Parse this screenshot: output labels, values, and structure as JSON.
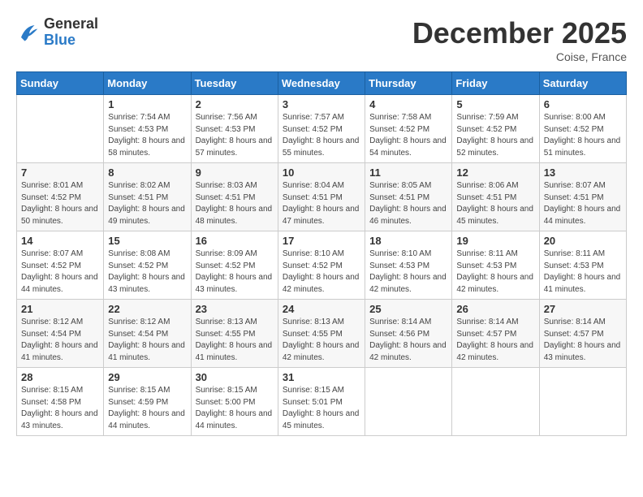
{
  "header": {
    "logo_general": "General",
    "logo_blue": "Blue",
    "month_title": "December 2025",
    "location": "Coise, France"
  },
  "weekdays": [
    "Sunday",
    "Monday",
    "Tuesday",
    "Wednesday",
    "Thursday",
    "Friday",
    "Saturday"
  ],
  "weeks": [
    [
      {
        "day": "",
        "sunrise": "",
        "sunset": "",
        "daylight": ""
      },
      {
        "day": "1",
        "sunrise": "Sunrise: 7:54 AM",
        "sunset": "Sunset: 4:53 PM",
        "daylight": "Daylight: 8 hours and 58 minutes."
      },
      {
        "day": "2",
        "sunrise": "Sunrise: 7:56 AM",
        "sunset": "Sunset: 4:53 PM",
        "daylight": "Daylight: 8 hours and 57 minutes."
      },
      {
        "day": "3",
        "sunrise": "Sunrise: 7:57 AM",
        "sunset": "Sunset: 4:52 PM",
        "daylight": "Daylight: 8 hours and 55 minutes."
      },
      {
        "day": "4",
        "sunrise": "Sunrise: 7:58 AM",
        "sunset": "Sunset: 4:52 PM",
        "daylight": "Daylight: 8 hours and 54 minutes."
      },
      {
        "day": "5",
        "sunrise": "Sunrise: 7:59 AM",
        "sunset": "Sunset: 4:52 PM",
        "daylight": "Daylight: 8 hours and 52 minutes."
      },
      {
        "day": "6",
        "sunrise": "Sunrise: 8:00 AM",
        "sunset": "Sunset: 4:52 PM",
        "daylight": "Daylight: 8 hours and 51 minutes."
      }
    ],
    [
      {
        "day": "7",
        "sunrise": "Sunrise: 8:01 AM",
        "sunset": "Sunset: 4:52 PM",
        "daylight": "Daylight: 8 hours and 50 minutes."
      },
      {
        "day": "8",
        "sunrise": "Sunrise: 8:02 AM",
        "sunset": "Sunset: 4:51 PM",
        "daylight": "Daylight: 8 hours and 49 minutes."
      },
      {
        "day": "9",
        "sunrise": "Sunrise: 8:03 AM",
        "sunset": "Sunset: 4:51 PM",
        "daylight": "Daylight: 8 hours and 48 minutes."
      },
      {
        "day": "10",
        "sunrise": "Sunrise: 8:04 AM",
        "sunset": "Sunset: 4:51 PM",
        "daylight": "Daylight: 8 hours and 47 minutes."
      },
      {
        "day": "11",
        "sunrise": "Sunrise: 8:05 AM",
        "sunset": "Sunset: 4:51 PM",
        "daylight": "Daylight: 8 hours and 46 minutes."
      },
      {
        "day": "12",
        "sunrise": "Sunrise: 8:06 AM",
        "sunset": "Sunset: 4:51 PM",
        "daylight": "Daylight: 8 hours and 45 minutes."
      },
      {
        "day": "13",
        "sunrise": "Sunrise: 8:07 AM",
        "sunset": "Sunset: 4:51 PM",
        "daylight": "Daylight: 8 hours and 44 minutes."
      }
    ],
    [
      {
        "day": "14",
        "sunrise": "Sunrise: 8:07 AM",
        "sunset": "Sunset: 4:52 PM",
        "daylight": "Daylight: 8 hours and 44 minutes."
      },
      {
        "day": "15",
        "sunrise": "Sunrise: 8:08 AM",
        "sunset": "Sunset: 4:52 PM",
        "daylight": "Daylight: 8 hours and 43 minutes."
      },
      {
        "day": "16",
        "sunrise": "Sunrise: 8:09 AM",
        "sunset": "Sunset: 4:52 PM",
        "daylight": "Daylight: 8 hours and 43 minutes."
      },
      {
        "day": "17",
        "sunrise": "Sunrise: 8:10 AM",
        "sunset": "Sunset: 4:52 PM",
        "daylight": "Daylight: 8 hours and 42 minutes."
      },
      {
        "day": "18",
        "sunrise": "Sunrise: 8:10 AM",
        "sunset": "Sunset: 4:53 PM",
        "daylight": "Daylight: 8 hours and 42 minutes."
      },
      {
        "day": "19",
        "sunrise": "Sunrise: 8:11 AM",
        "sunset": "Sunset: 4:53 PM",
        "daylight": "Daylight: 8 hours and 42 minutes."
      },
      {
        "day": "20",
        "sunrise": "Sunrise: 8:11 AM",
        "sunset": "Sunset: 4:53 PM",
        "daylight": "Daylight: 8 hours and 41 minutes."
      }
    ],
    [
      {
        "day": "21",
        "sunrise": "Sunrise: 8:12 AM",
        "sunset": "Sunset: 4:54 PM",
        "daylight": "Daylight: 8 hours and 41 minutes."
      },
      {
        "day": "22",
        "sunrise": "Sunrise: 8:12 AM",
        "sunset": "Sunset: 4:54 PM",
        "daylight": "Daylight: 8 hours and 41 minutes."
      },
      {
        "day": "23",
        "sunrise": "Sunrise: 8:13 AM",
        "sunset": "Sunset: 4:55 PM",
        "daylight": "Daylight: 8 hours and 41 minutes."
      },
      {
        "day": "24",
        "sunrise": "Sunrise: 8:13 AM",
        "sunset": "Sunset: 4:55 PM",
        "daylight": "Daylight: 8 hours and 42 minutes."
      },
      {
        "day": "25",
        "sunrise": "Sunrise: 8:14 AM",
        "sunset": "Sunset: 4:56 PM",
        "daylight": "Daylight: 8 hours and 42 minutes."
      },
      {
        "day": "26",
        "sunrise": "Sunrise: 8:14 AM",
        "sunset": "Sunset: 4:57 PM",
        "daylight": "Daylight: 8 hours and 42 minutes."
      },
      {
        "day": "27",
        "sunrise": "Sunrise: 8:14 AM",
        "sunset": "Sunset: 4:57 PM",
        "daylight": "Daylight: 8 hours and 43 minutes."
      }
    ],
    [
      {
        "day": "28",
        "sunrise": "Sunrise: 8:15 AM",
        "sunset": "Sunset: 4:58 PM",
        "daylight": "Daylight: 8 hours and 43 minutes."
      },
      {
        "day": "29",
        "sunrise": "Sunrise: 8:15 AM",
        "sunset": "Sunset: 4:59 PM",
        "daylight": "Daylight: 8 hours and 44 minutes."
      },
      {
        "day": "30",
        "sunrise": "Sunrise: 8:15 AM",
        "sunset": "Sunset: 5:00 PM",
        "daylight": "Daylight: 8 hours and 44 minutes."
      },
      {
        "day": "31",
        "sunrise": "Sunrise: 8:15 AM",
        "sunset": "Sunset: 5:01 PM",
        "daylight": "Daylight: 8 hours and 45 minutes."
      },
      {
        "day": "",
        "sunrise": "",
        "sunset": "",
        "daylight": ""
      },
      {
        "day": "",
        "sunrise": "",
        "sunset": "",
        "daylight": ""
      },
      {
        "day": "",
        "sunrise": "",
        "sunset": "",
        "daylight": ""
      }
    ]
  ]
}
